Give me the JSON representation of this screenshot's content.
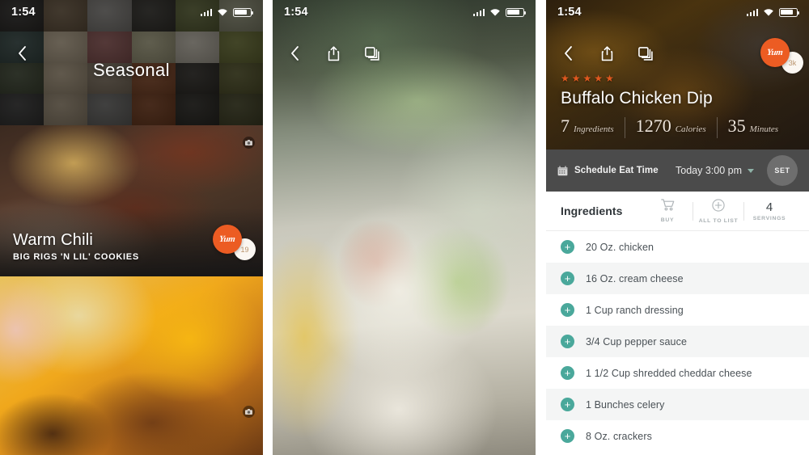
{
  "status_bar": {
    "time": "1:54",
    "signal_icon": "signal-bars-icon",
    "wifi_icon": "wifi-icon",
    "battery_icon": "battery-icon"
  },
  "panel1": {
    "nav": {
      "back_icon": "chevron-left-icon"
    },
    "header_title": "Seasonal",
    "cards": [
      {
        "title": "Warm Chili",
        "subtitle": "BIG RIGS 'N LIL' COOKIES",
        "yum_label": "Yum",
        "yum_count": "19",
        "camera_icon": "camera-icon"
      },
      {
        "title": "",
        "subtitle": "",
        "camera_icon": "camera-icon"
      }
    ]
  },
  "panel2": {
    "nav": {
      "back_icon": "chevron-left-icon",
      "share_icon": "share-icon",
      "cards_icon": "stacked-cards-icon"
    }
  },
  "panel3": {
    "nav": {
      "back_icon": "chevron-left-icon",
      "share_icon": "share-icon",
      "cards_icon": "stacked-cards-icon"
    },
    "yum": {
      "label": "Yum",
      "count": "3k"
    },
    "rating": 5,
    "recipe_title": "Buffalo Chicken Dip",
    "stats": [
      {
        "value": "7",
        "label": "Ingredients"
      },
      {
        "value": "1270",
        "label": "Calories"
      },
      {
        "value": "35",
        "label": "Minutes"
      }
    ],
    "schedule": {
      "calendar_icon": "calendar-icon",
      "label": "Schedule Eat Time",
      "time_value": "Today 3:00 pm",
      "chevron_icon": "chevron-down-icon",
      "set_button": "SET"
    },
    "ingredients_header": {
      "title": "Ingredients",
      "actions": [
        {
          "icon": "shopping-cart-icon",
          "label": "BUY"
        },
        {
          "icon": "plus-circle-icon",
          "label": "ALL TO LIST"
        },
        {
          "value": "4",
          "label": "SERVINGS"
        }
      ]
    },
    "ingredients": [
      "20 Oz. chicken",
      "16 Oz. cream cheese",
      "1 Cup ranch dressing",
      "3/4 Cup pepper sauce",
      "1 1/2 Cup shredded cheddar cheese",
      "1 Bunches celery",
      "8 Oz. crackers"
    ],
    "add_icon": "plus-circle-icon"
  },
  "colors": {
    "yum_orange": "#ec5c23",
    "teal_accent": "#4aa89b",
    "star_orange": "#e0581f",
    "schedule_bar": "#4b4b4b"
  }
}
